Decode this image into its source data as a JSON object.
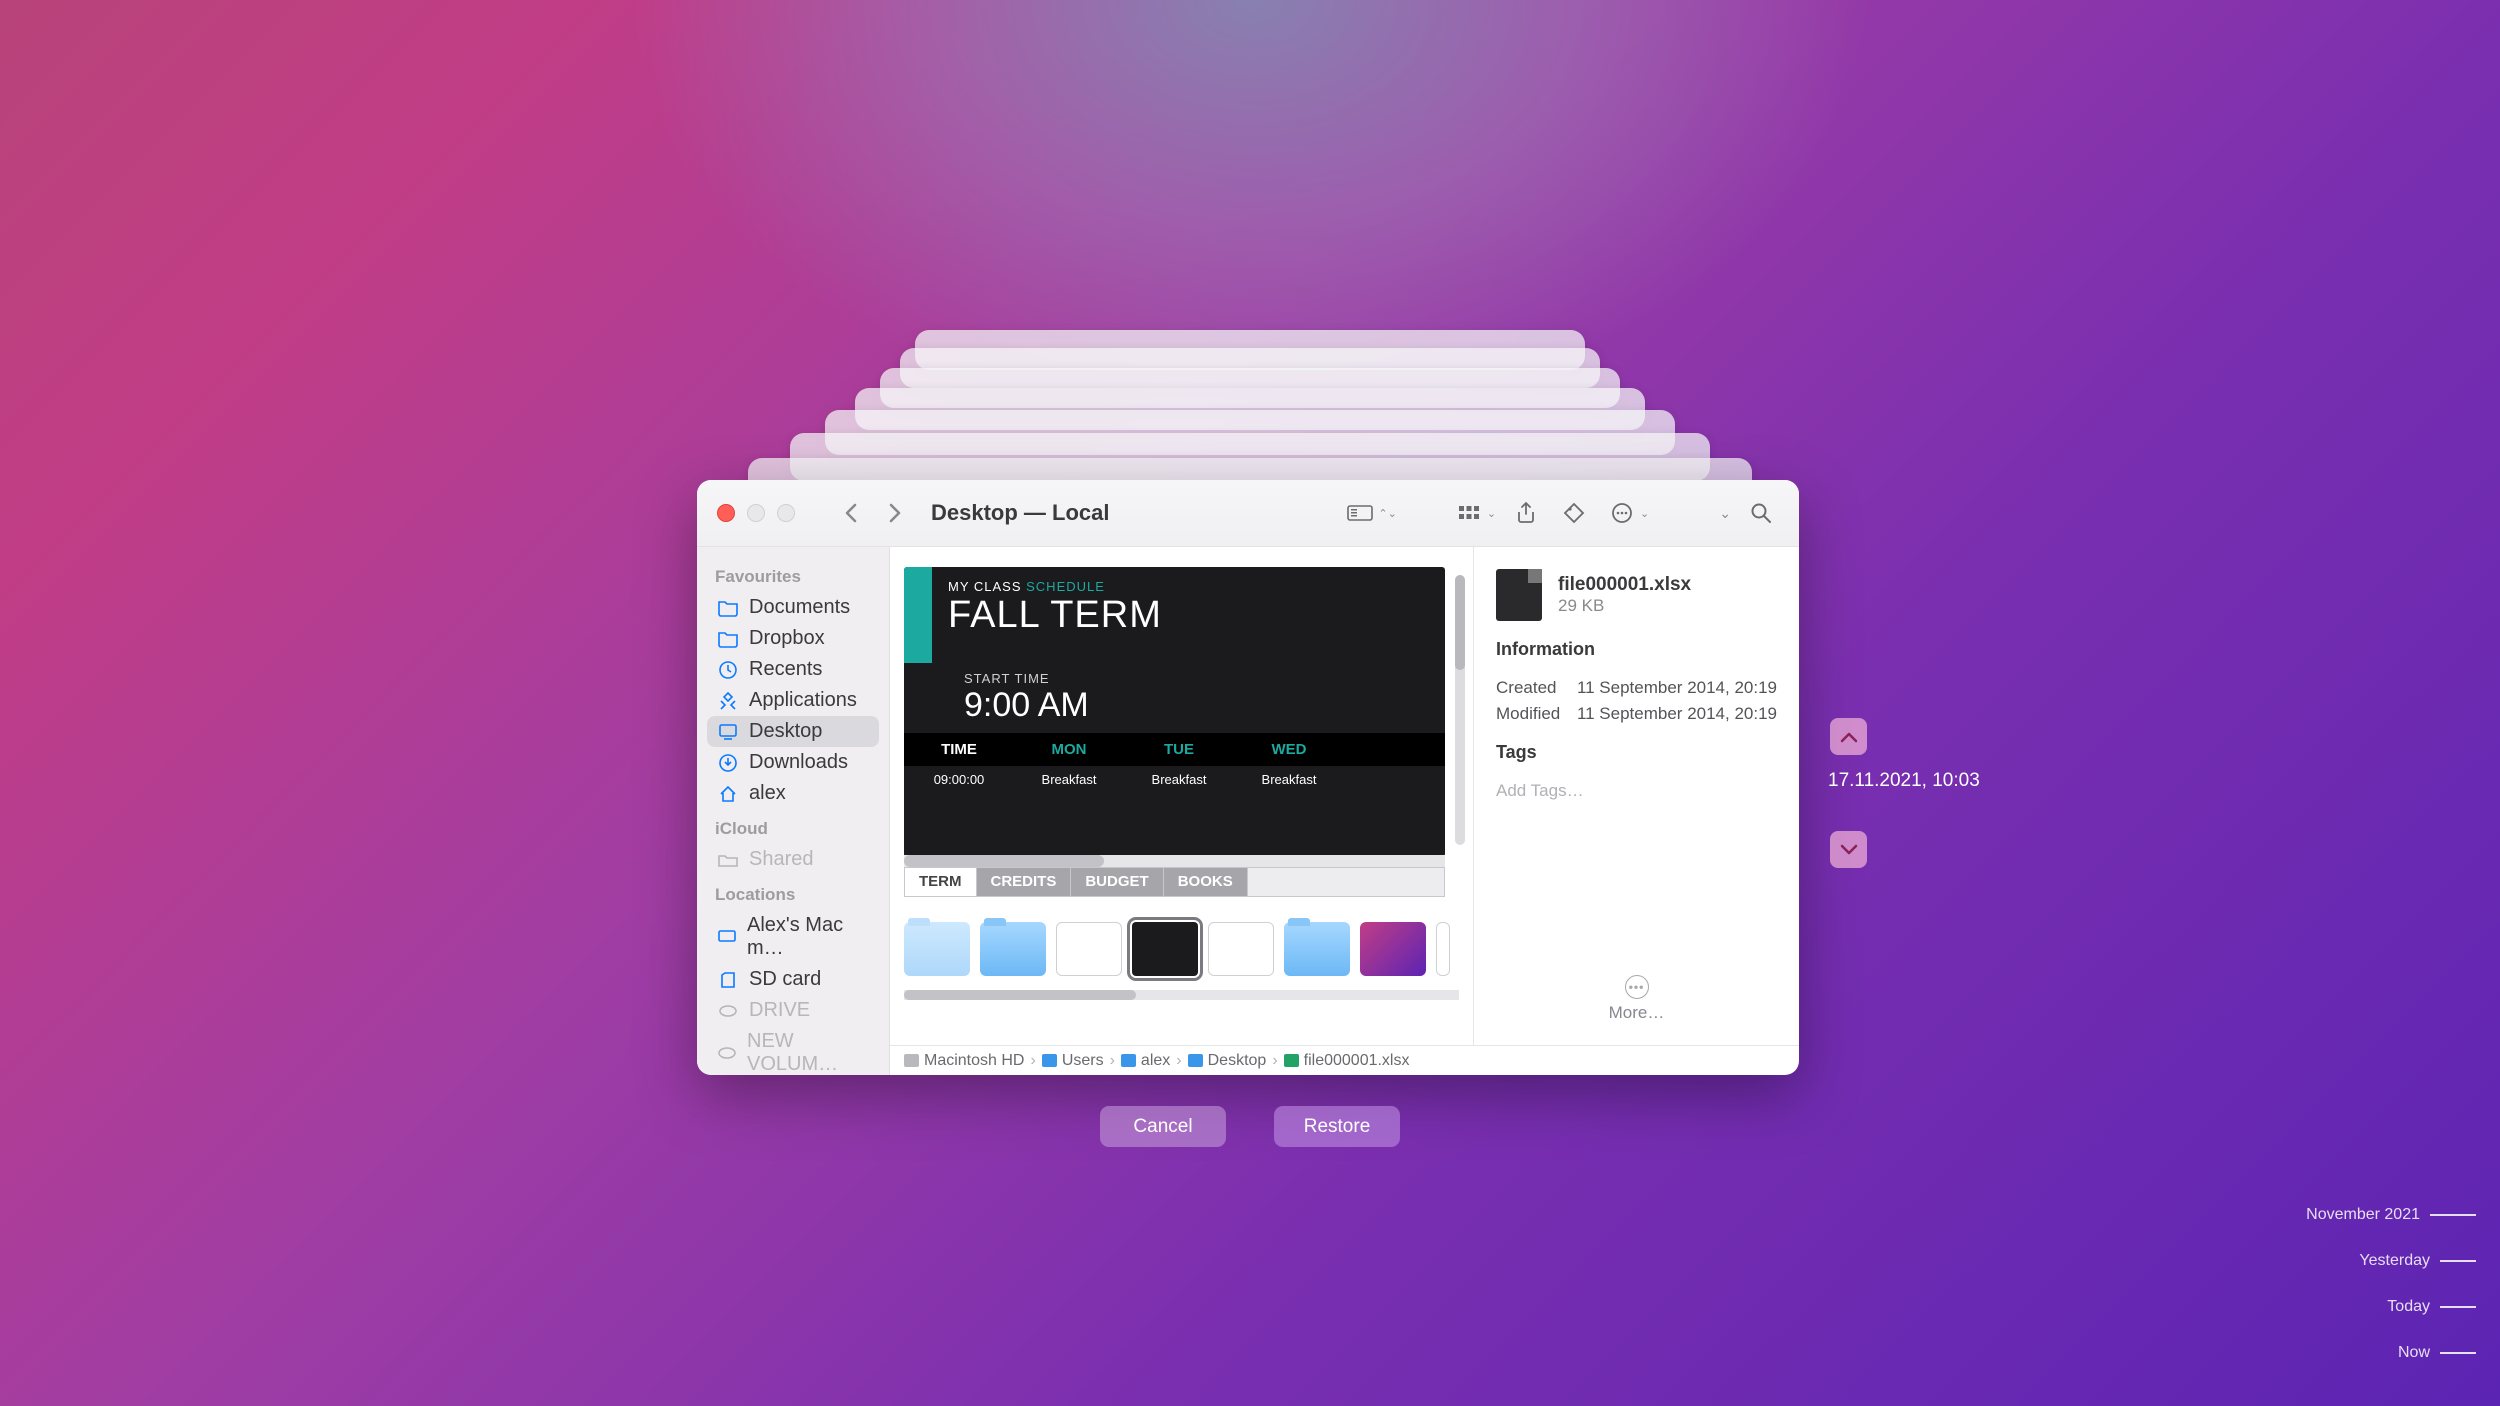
{
  "title": "Desktop — Local",
  "sidebar": {
    "sections": [
      {
        "heading": "Favourites",
        "items": [
          {
            "icon": "folder",
            "label": "Documents"
          },
          {
            "icon": "folder",
            "label": "Dropbox"
          },
          {
            "icon": "clock",
            "label": "Recents"
          },
          {
            "icon": "apps",
            "label": "Applications"
          },
          {
            "icon": "display",
            "label": "Desktop",
            "selected": true
          },
          {
            "icon": "download",
            "label": "Downloads"
          },
          {
            "icon": "home",
            "label": "alex"
          }
        ]
      },
      {
        "heading": "iCloud",
        "items": [
          {
            "icon": "shared",
            "label": "Shared",
            "disabled": true
          }
        ]
      },
      {
        "heading": "Locations",
        "items": [
          {
            "icon": "computer",
            "label": "Alex's Mac m…"
          },
          {
            "icon": "sdcard",
            "label": "SD card"
          },
          {
            "icon": "drive",
            "label": "DRIVE",
            "disabled": true
          },
          {
            "icon": "drive",
            "label": "NEW VOLUM…",
            "disabled": true
          }
        ]
      }
    ]
  },
  "preview": {
    "subtitle_white": "MY CLASS ",
    "subtitle_teal": "SCHEDULE",
    "title": "FALL TERM",
    "start_label": "START TIME",
    "start_time": "9:00 AM",
    "table": {
      "headers": [
        "TIME",
        "MON",
        "TUE",
        "WED"
      ],
      "row1": [
        "09:00:00",
        "Breakfast",
        "Breakfast",
        "Breakfast"
      ]
    },
    "sheet_tabs": [
      "TERM",
      "CREDITS",
      "BUDGET",
      "BOOKS"
    ],
    "active_tab": 0
  },
  "info": {
    "filename": "file000001.xlsx",
    "filesize": "29 KB",
    "heading": "Information",
    "rows": [
      {
        "label": "Created",
        "value": "11 September 2014, 20:19"
      },
      {
        "label": "Modified",
        "value": "11 September 2014, 20:19"
      }
    ],
    "tags_heading": "Tags",
    "tags_placeholder": "Add Tags…",
    "more_label": "More…"
  },
  "pathbar": [
    {
      "type": "disk",
      "label": "Macintosh HD"
    },
    {
      "type": "fld",
      "label": "Users"
    },
    {
      "type": "fld",
      "label": "alex"
    },
    {
      "type": "fld",
      "label": "Desktop"
    },
    {
      "type": "xls",
      "label": "file000001.xlsx"
    }
  ],
  "snapshot_time": "17.11.2021, 10:03",
  "buttons": {
    "cancel": "Cancel",
    "restore": "Restore"
  },
  "timeline": [
    "November 2021",
    "Yesterday",
    "Today",
    "Now"
  ]
}
